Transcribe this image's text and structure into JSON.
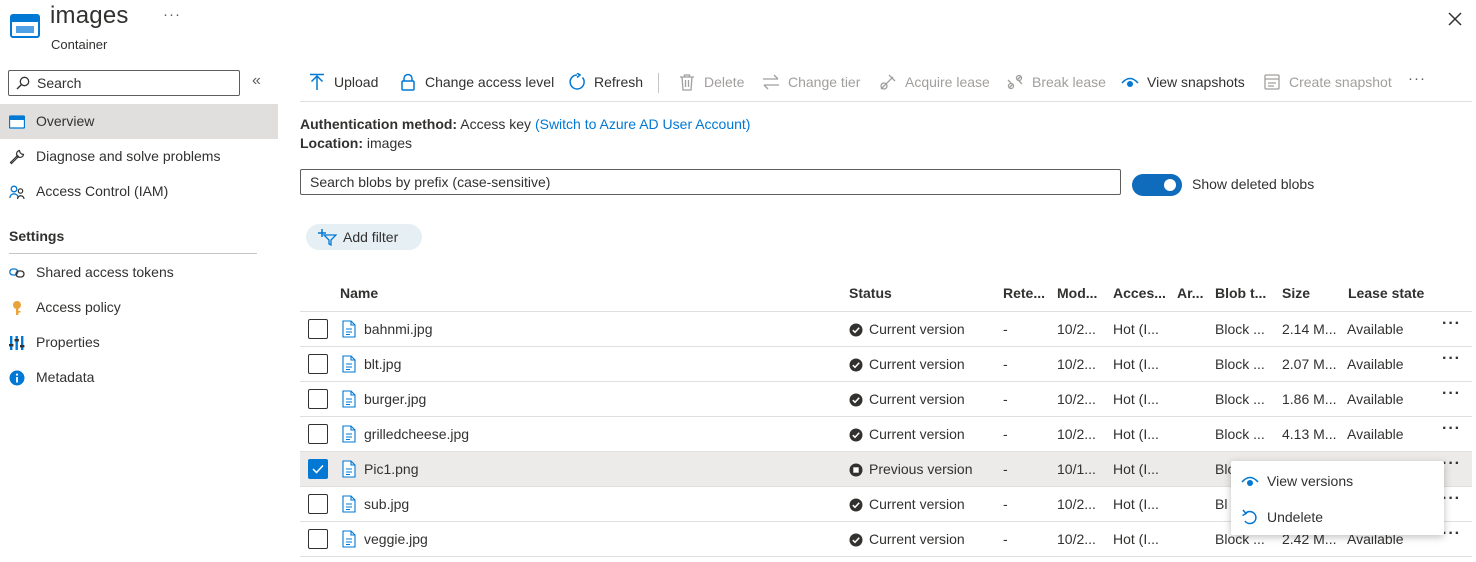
{
  "header": {
    "title": "images",
    "subtitle": "Container",
    "more": "···",
    "icons": {
      "container": "container-icon",
      "close": "close-icon"
    }
  },
  "sidebar": {
    "search_placeholder": "Search",
    "collapse": "«",
    "items": [
      {
        "label": "Overview",
        "icon": "overview-icon",
        "active": true
      },
      {
        "label": "Diagnose and solve problems",
        "icon": "wrench-icon"
      },
      {
        "label": "Access Control (IAM)",
        "icon": "people-icon"
      }
    ],
    "group_title": "Settings",
    "settings_items": [
      {
        "label": "Shared access tokens",
        "icon": "link-icon"
      },
      {
        "label": "Access policy",
        "icon": "key-icon"
      },
      {
        "label": "Properties",
        "icon": "properties-icon"
      },
      {
        "label": "Metadata",
        "icon": "info-icon"
      }
    ]
  },
  "toolbar": {
    "upload": "Upload",
    "change_access": "Change access level",
    "refresh": "Refresh",
    "delete": "Delete",
    "change_tier": "Change tier",
    "acquire_lease": "Acquire lease",
    "break_lease": "Break lease",
    "view_snapshots": "View snapshots",
    "create_snapshot": "Create snapshot",
    "more": "···"
  },
  "info": {
    "auth_label": "Authentication method:",
    "auth_value": "Access key",
    "auth_link": "(Switch to Azure AD User Account)",
    "location_label": "Location:",
    "location_value": "images"
  },
  "blob_search": {
    "placeholder": "Search blobs by prefix (case-sensitive)"
  },
  "toggle": {
    "label": "Show deleted blobs",
    "on": true
  },
  "filter": {
    "label": "Add filter"
  },
  "table": {
    "columns": [
      "Name",
      "Status",
      "Rete...",
      "Mod...",
      "Acces...",
      "Ar...",
      "Blob t...",
      "Size",
      "Lease state"
    ],
    "rows": [
      {
        "name": "bahnmi.jpg",
        "status": "Current version",
        "retention": "-",
        "modified": "10/2...",
        "access": "Hot (I...",
        "archive": "",
        "blob_type": "Block ...",
        "size": "2.14 M...",
        "lease": "Available",
        "checked": false
      },
      {
        "name": "blt.jpg",
        "status": "Current version",
        "retention": "-",
        "modified": "10/2...",
        "access": "Hot (I...",
        "archive": "",
        "blob_type": "Block ...",
        "size": "2.07 M...",
        "lease": "Available",
        "checked": false
      },
      {
        "name": "burger.jpg",
        "status": "Current version",
        "retention": "-",
        "modified": "10/2...",
        "access": "Hot (I...",
        "archive": "",
        "blob_type": "Block ...",
        "size": "1.86 M...",
        "lease": "Available",
        "checked": false
      },
      {
        "name": "grilledcheese.jpg",
        "status": "Current version",
        "retention": "-",
        "modified": "10/2...",
        "access": "Hot (I...",
        "archive": "",
        "blob_type": "Block ...",
        "size": "4.13 M...",
        "lease": "Available",
        "checked": false
      },
      {
        "name": "Pic1.png",
        "status": "Previous version",
        "retention": "-",
        "modified": "10/1...",
        "access": "Hot (I...",
        "archive": "",
        "blob_type": "Blo",
        "size": "",
        "lease": "",
        "checked": true
      },
      {
        "name": "sub.jpg",
        "status": "Current version",
        "retention": "-",
        "modified": "10/2...",
        "access": "Hot (I...",
        "archive": "",
        "blob_type": "Bl",
        "size": "",
        "lease": "",
        "checked": false
      },
      {
        "name": "veggie.jpg",
        "status": "Current version",
        "retention": "-",
        "modified": "10/2...",
        "access": "Hot (I...",
        "archive": "",
        "blob_type": "Block ...",
        "size": "2.42 M...",
        "lease": "Available",
        "checked": false
      }
    ],
    "row_more": "···"
  },
  "context_menu": {
    "items": [
      {
        "label": "View versions",
        "icon": "eye-icon"
      },
      {
        "label": "Undelete",
        "icon": "undo-icon"
      }
    ]
  },
  "colors": {
    "accent": "#0078d4",
    "toggle": "#0f6cbd",
    "selected_row": "#edebe9",
    "active_nav": "#e1dfdd"
  }
}
